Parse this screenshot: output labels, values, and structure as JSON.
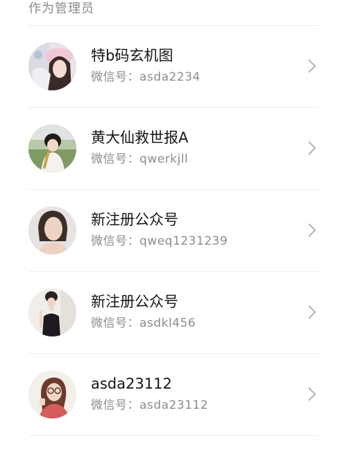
{
  "section_header": "作为管理员",
  "accounts": [
    {
      "name": "特b码玄机图",
      "id_label": "微信号：",
      "id_value": "asda2234",
      "avatar_icon": "avatar-girl-pink-hat",
      "chevron_icon": "chevron-right-icon"
    },
    {
      "name": "黄大仙救世报A",
      "id_label": "微信号：",
      "id_value": "qwerkjll",
      "avatar_icon": "avatar-girl-flute",
      "chevron_icon": "chevron-right-icon"
    },
    {
      "name": "新注册公众号",
      "id_label": "微信号：",
      "id_value": "qweq1231239",
      "avatar_icon": "avatar-woman-portrait",
      "chevron_icon": "chevron-right-icon"
    },
    {
      "name": "新注册公众号",
      "id_label": "微信号：",
      "id_value": "asdkl456",
      "avatar_icon": "avatar-woman-dress",
      "chevron_icon": "chevron-right-icon"
    },
    {
      "name": "asda23112",
      "id_label": "微信号：",
      "id_value": "asda23112",
      "avatar_icon": "avatar-girl-glasses",
      "chevron_icon": "chevron-right-icon"
    }
  ],
  "colors": {
    "title_text": "#161616",
    "secondary_text": "#8c8c8c",
    "divider": "#ededed",
    "chevron": "#b2b2b2"
  }
}
